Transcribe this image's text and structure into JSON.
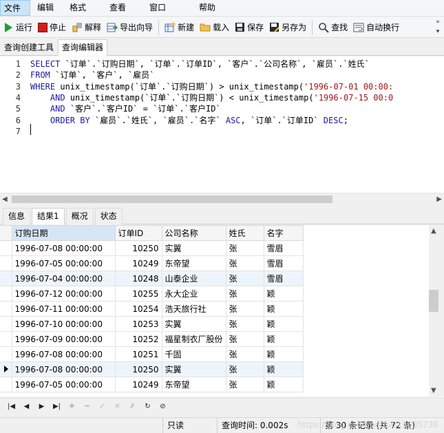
{
  "menu": [
    "文件",
    "编辑",
    "格式",
    "查看",
    "窗口",
    "帮助"
  ],
  "toolbar": {
    "run": "运行",
    "stop": "停止",
    "explain": "解释",
    "export_wizard": "导出向导",
    "new": "新建",
    "load": "载入",
    "save": "保存",
    "save_as": "另存为",
    "find": "查找",
    "word_wrap": "自动换行",
    "more": "»"
  },
  "editor_tabs": [
    "查询创建工具",
    "查询编辑器"
  ],
  "editor": {
    "lines": [
      {
        "n": "1",
        "parts": [
          [
            "kw",
            "SELECT"
          ],
          [
            "t",
            " `订单`.`订购日期`, `订单`.`订单ID`, `客户`.`公司名称`, `雇员`.`姓氏`"
          ]
        ]
      },
      {
        "n": "2",
        "parts": [
          [
            "kw",
            "FROM"
          ],
          [
            "t",
            " `订单`, `客户`, `雇员`"
          ]
        ]
      },
      {
        "n": "3",
        "parts": [
          [
            "kw",
            "WHERE"
          ],
          [
            "t",
            " unix_timestamp(`订单`.`订购日期`) > unix_timestamp("
          ],
          [
            "str",
            "'1996-07-01 00:00:"
          ]
        ]
      },
      {
        "n": "4",
        "parts": [
          [
            "t",
            "    "
          ],
          [
            "kw",
            "AND"
          ],
          [
            "t",
            " unix_timestamp(`订单`.`订购日期`) < unix_timestamp("
          ],
          [
            "str",
            "'1996-07-15 00:0"
          ]
        ]
      },
      {
        "n": "5",
        "parts": [
          [
            "t",
            "    "
          ],
          [
            "kw",
            "AND"
          ],
          [
            "t",
            " `客户`.`客户ID` = `订单`.`客户ID`"
          ]
        ]
      },
      {
        "n": "6",
        "parts": [
          [
            "t",
            "    "
          ],
          [
            "kw",
            "ORDER BY"
          ],
          [
            "t",
            " `雇员`.`姓氏`, `雇员`.`名字` "
          ],
          [
            "kw",
            "ASC"
          ],
          [
            "t",
            ", `订单`.`订单ID` "
          ],
          [
            "kw",
            "DESC"
          ],
          [
            "t",
            ";"
          ]
        ]
      },
      {
        "n": "7",
        "parts": []
      }
    ]
  },
  "result_tabs": [
    "信息",
    "结果1",
    "概况",
    "状态"
  ],
  "grid": {
    "columns": [
      "订购日期",
      "订单ID",
      "公司名称",
      "姓氏",
      "名字"
    ],
    "rows": [
      [
        "1996-07-08 00:00:00",
        "10250",
        "实翼",
        "张",
        "雪眉"
      ],
      [
        "1996-07-05 00:00:00",
        "10249",
        "东帝望",
        "张",
        "雪眉"
      ],
      [
        "1996-07-04 00:00:00",
        "10248",
        "山泰企业",
        "张",
        "雪眉"
      ],
      [
        "1996-07-12 00:00:00",
        "10255",
        "永大企业",
        "张",
        "颖"
      ],
      [
        "1996-07-11 00:00:00",
        "10254",
        "浩天旅行社",
        "张",
        "颖"
      ],
      [
        "1996-07-10 00:00:00",
        "10253",
        "实翼",
        "张",
        "颖"
      ],
      [
        "1996-07-09 00:00:00",
        "10252",
        "福星制衣厂股份",
        "张",
        "颖"
      ],
      [
        "1996-07-08 00:00:00",
        "10251",
        "千固",
        "张",
        "颖"
      ],
      [
        "1996-07-08 00:00:00",
        "10250",
        "实翼",
        "张",
        "颖"
      ],
      [
        "1996-07-05 00:00:00",
        "10249",
        "东帝望",
        "张",
        "颖"
      ]
    ]
  },
  "nav": [
    "first-icon",
    "prev-icon",
    "next-icon",
    "last-icon",
    "add-icon",
    "delete-icon",
    "apply-icon",
    "cancel-icon",
    "clear-icon",
    "refresh-icon",
    "stop-icon"
  ],
  "status": {
    "mode": "只读",
    "query_time": "查询时间: 0.002s",
    "record": "第 30 条记录 (共 72 条)",
    "watermark": "https://blog.csdn.net/u013635736"
  },
  "colors": {
    "keyword": "#1a1aa6",
    "string": "#a31515",
    "selected_row": "#eef4fb"
  }
}
